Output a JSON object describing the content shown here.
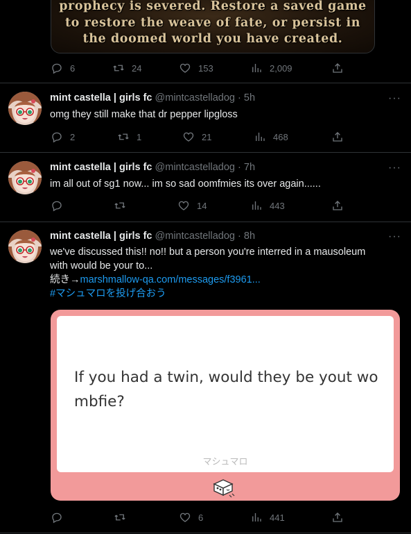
{
  "top_post": {
    "game_text": [
      "prophecy is severed. Restore a saved game",
      "to restore the weave of fate, or persist in",
      "the doomed world you have created."
    ],
    "actions": {
      "replies": "6",
      "retweets": "24",
      "likes": "153",
      "views": "2,009"
    }
  },
  "tweets": [
    {
      "name": "mint castella | girls fc",
      "handle": "@mintcastelladog",
      "time": "· 5h",
      "text": "omg they still make that dr pepper lipgloss",
      "actions": {
        "replies": "2",
        "retweets": "1",
        "likes": "21",
        "views": "468"
      }
    },
    {
      "name": "mint castella | girls fc",
      "handle": "@mintcastelladog",
      "time": "· 7h",
      "text": "im all out of sg1 now... im so sad oomfmies its over again......",
      "actions": {
        "replies": "",
        "retweets": "",
        "likes": "14",
        "views": "443"
      }
    },
    {
      "name": "mint castella | girls fc",
      "handle": "@mintcastelladog",
      "time": "· 8h",
      "text_line1": "we've discussed this!! no!! but a person you're interred in a mausoleum",
      "text_line2": "with would be your to...",
      "more_prefix": "続き→",
      "more_link": "marshmallow-qa.com/messages/f3961...",
      "hashtag": "#マシュマロを投げ合おう",
      "card": {
        "question": "If you had a twin, would they be yout wombfie?",
        "brand": "マシュマロ"
      },
      "actions": {
        "replies": "",
        "retweets": "",
        "likes": "6",
        "views": "441"
      }
    }
  ],
  "ui": {
    "more": "···"
  },
  "colors": {
    "accent": "#1d9bf0",
    "muted": "#71767b",
    "card_bg": "#f29a9a"
  }
}
